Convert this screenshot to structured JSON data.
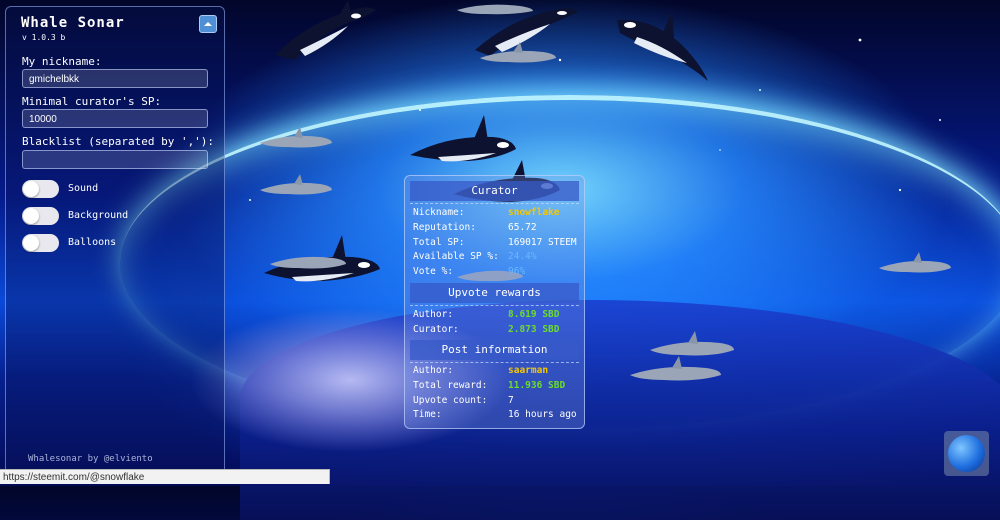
{
  "app": {
    "title": "Whale Sonar",
    "version": "v 1.0.3 b",
    "credit": "Whalesonar by @elviento"
  },
  "settings": {
    "nickname_label": "My nickname:",
    "nickname_value": "gmichelbkk",
    "min_sp_label": "Minimal curator's SP:",
    "min_sp_value": "10000",
    "blacklist_label": "Blacklist (separated by ','):",
    "blacklist_value": "",
    "toggles": [
      {
        "label": "Sound",
        "on": false
      },
      {
        "label": "Background",
        "on": false
      },
      {
        "label": "Balloons",
        "on": false
      }
    ]
  },
  "curator": {
    "heading": "Curator",
    "rows": [
      {
        "key": "Nickname:",
        "value": "snowflake"
      },
      {
        "key": "Reputation:",
        "value": "65.72"
      },
      {
        "key": "Total SP:",
        "value": "169017 STEEM"
      },
      {
        "key": "Available SP %:",
        "value": "24.4%"
      },
      {
        "key": "Vote %:",
        "value": "96%"
      }
    ]
  },
  "upvote_rewards": {
    "heading": "Upvote rewards",
    "rows": [
      {
        "key": "Author:",
        "value": "8.619 SBD"
      },
      {
        "key": "Curator:",
        "value": "2.873 SBD"
      }
    ]
  },
  "post_information": {
    "heading": "Post information",
    "rows": [
      {
        "key": "Author:",
        "value": "saarman"
      },
      {
        "key": "Total reward:",
        "value": "11.936 SBD"
      },
      {
        "key": "Upvote count:",
        "value": "7"
      },
      {
        "key": "Time:",
        "value": "16 hours ago"
      }
    ]
  },
  "status_bar": {
    "url": "https://steemit.com/@snowflake"
  },
  "colors": {
    "accent_yellow": "#f5c700",
    "accent_green": "#6bdc2a",
    "accent_blue": "#66b8ff"
  },
  "icons": {
    "collapse": "chevron-up-icon",
    "globe": "globe-icon",
    "whale": "orca-icon",
    "dolphin": "dolphin-icon"
  }
}
